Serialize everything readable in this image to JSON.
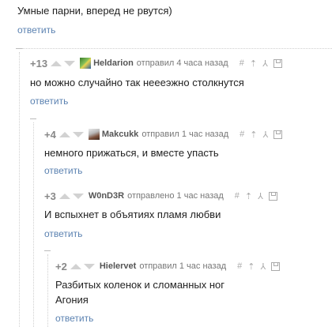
{
  "root": {
    "text": "Умные парни, вперед не рвутся)",
    "reply": "ответить"
  },
  "comments": [
    {
      "rating": "+13",
      "user": "Heldarion",
      "meta": "отправил 4 часа назад",
      "text": "но можно случайно так неееэжно столкнутся",
      "reply": "ответить"
    },
    {
      "rating": "+4",
      "user": "Makcukk",
      "meta": "отправил 1 час назад",
      "text": "немного прижаться, и вместе упасть",
      "reply": "ответить"
    },
    {
      "rating": "+3",
      "user": "W0nD3R",
      "meta": "отправлено 1 час назад",
      "text": "И вспыхнет в объятиях пламя любви",
      "reply": "ответить"
    },
    {
      "rating": "+2",
      "user": "Hielervet",
      "meta": "отправил 1 час назад",
      "text_lines": [
        "Разбитых коленок и сломанных ног",
        "Агония"
      ],
      "reply": "ответить"
    }
  ],
  "icons": {
    "hash": "#",
    "pin": "⇡",
    "branch": "⅄"
  },
  "colors": {
    "link": "#5b82b1",
    "vote_arrow": "#d2d2d2",
    "rating": "#888888"
  }
}
